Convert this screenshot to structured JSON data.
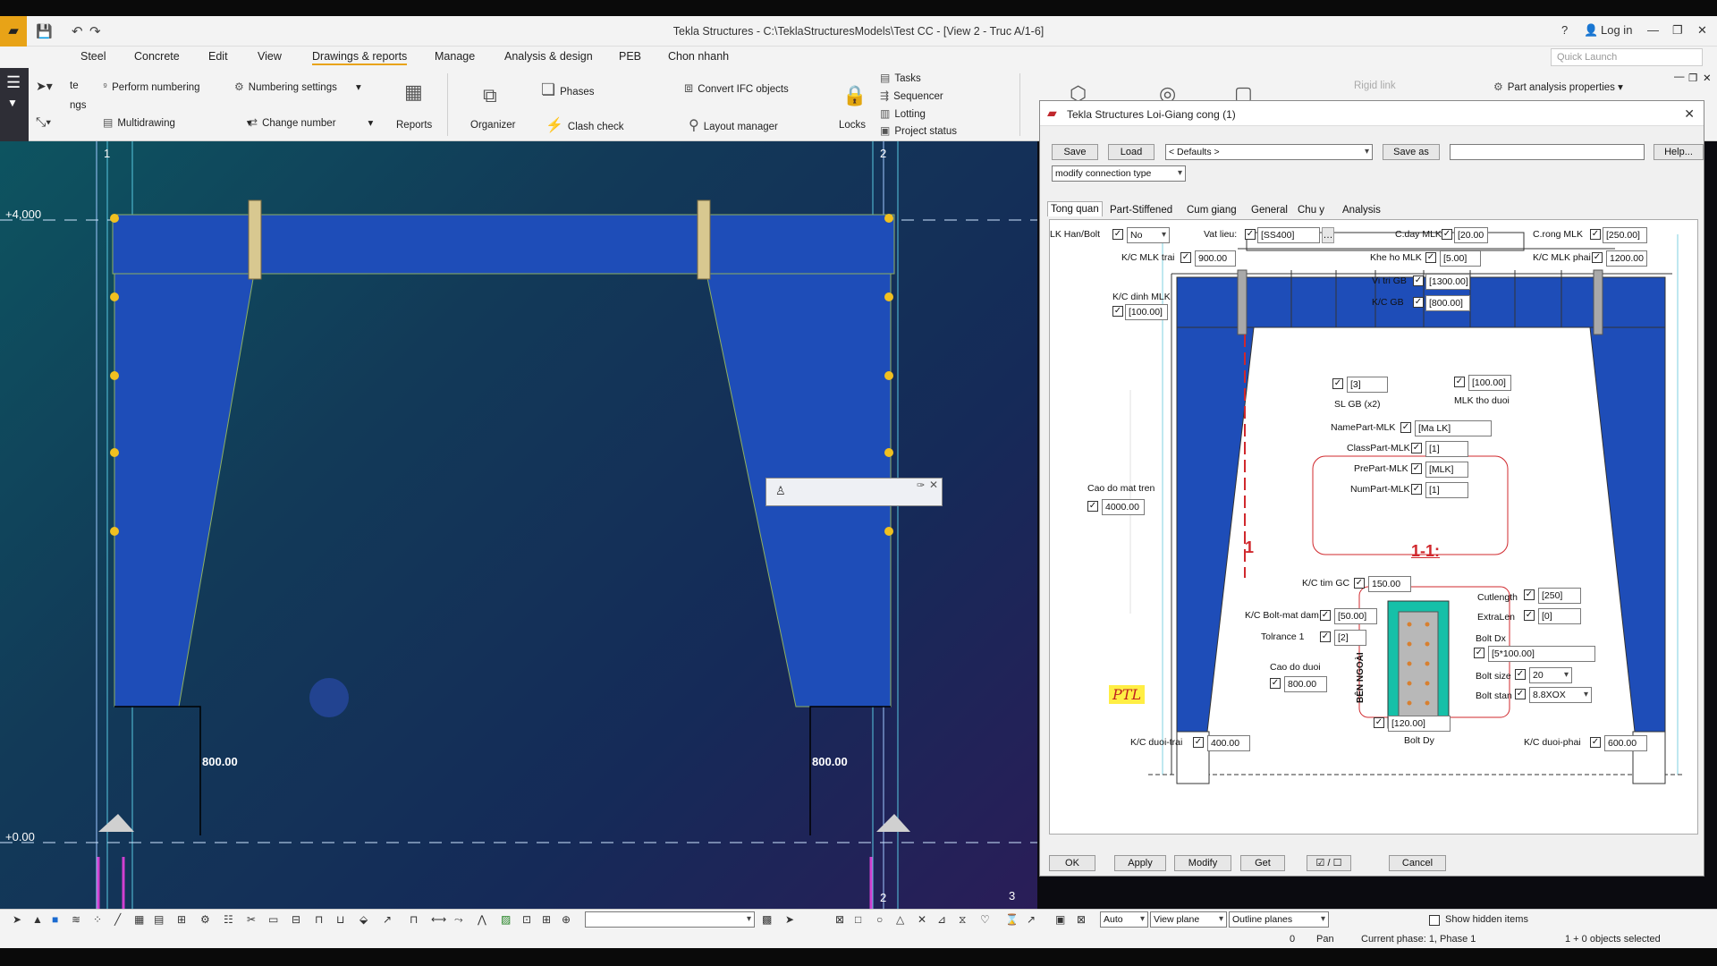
{
  "window": {
    "title": "Tekla Structures - C:\\TeklaStructuresModels\\Test CC - [View 2 - Truc A/1-6]",
    "login": "Log in",
    "help": "?"
  },
  "menu": [
    "Steel",
    "Concrete",
    "Edit",
    "View",
    "Drawings & reports",
    "Manage",
    "Analysis & design",
    "PEB",
    "Chon nhanh"
  ],
  "quick_launch": "Quick Launch",
  "ribbon": {
    "perform_numbering": "Perform numbering",
    "numbering_settings": "Numbering settings",
    "multidrawing": "Multidrawing",
    "change_number": "Change number",
    "reports": "Reports",
    "organizer": "Organizer",
    "phases": "Phases",
    "clash_check": "Clash check",
    "convert_ifc": "Convert IFC objects",
    "layout_manager": "Layout manager",
    "locks": "Locks",
    "tasks": "Tasks",
    "sequencer": "Sequencer",
    "lotting": "Lotting",
    "project_status": "Project status",
    "rigid_link": "Rigid link",
    "part_analysis": "Part analysis properties",
    "te": "te",
    "ngs": "ngs"
  },
  "viewport": {
    "grid_1": "1",
    "grid_2": "2",
    "grid_2b": "2",
    "grid_3": "3",
    "level_top": "+4,000",
    "level_bottom": "+0.00",
    "dim_left": "800.00",
    "dim_right": "800.00"
  },
  "dialog": {
    "title": "Tekla Structures  Loi-Giang cong (1)",
    "save": "Save",
    "load": "Load",
    "defaults": "< Defaults >",
    "save_as": "Save as",
    "save_as_value": "",
    "help": "Help...",
    "modify_type": "modify connection type",
    "tabs": [
      "Tong quan",
      "Part-Stiffened",
      "Cum giang",
      "General",
      "Chu y",
      "Analysis"
    ],
    "fields": {
      "lk_han_bolt_label": "LK Han/Bolt",
      "lk_han_bolt_value": "No",
      "vat_lieu_label": "Vat lieu:",
      "vat_lieu_value": "[SS400]",
      "cday_label": "C.day MLK",
      "cday_value": "[20.00",
      "crong_label": "C.rong MLK",
      "crong_value": "[250.00]",
      "kc_mlk_trai_label": "K/C MLK trai",
      "kc_mlk_trai_value": "900.00",
      "khe_ho_label": "Khe ho MLK",
      "khe_ho_value": "[5.00]",
      "kc_mlk_phai_label": "K/C MLK phai",
      "kc_mlk_phai_value": "1200.00",
      "vitri_gb_label": "Vi tri GB",
      "vitri_gb_value": "[1300.00]",
      "kc_gb_label": "K/C GB",
      "kc_gb_value": "[800.00]",
      "kc_dinh_label": "K/C dinh MLK",
      "kc_dinh_value": "[100.00]",
      "sl_gb_value": "[3]",
      "sl_gb_label": "SL GB (x2)",
      "mlk_tho_value": "[100.00]",
      "mlk_tho_label": "MLK tho duoi",
      "namepart_label": "NamePart-MLK",
      "namepart_value": "[Ma LK]",
      "classpart_label": "ClassPart-MLK",
      "classpart_value": "[1]",
      "prepart_label": "PrePart-MLK",
      "prepart_value": "[MLK]",
      "numpart_label": "NumPart-MLK",
      "numpart_value": "[1]",
      "cao_do_tren_label": "Cao do mat tren",
      "cao_do_tren_value": "4000.00",
      "section_mark": "1",
      "section_label": "1-1:",
      "kc_tim_gc_label": "K/C tim GC",
      "kc_tim_gc_value": "150.00",
      "kc_bolt_label": "K/C Bolt-mat dam",
      "kc_bolt_value": "[50.00]",
      "tolrance_label": "Tolrance 1",
      "tolrance_value": "[2]",
      "cutlength_label": "Cutlength",
      "cutlength_value": "[250]",
      "extralen_label": "ExtraLen",
      "extralen_value": "[0]",
      "bolt_dx_label": "Bolt Dx",
      "bolt_dx_value": "[5*100.00]",
      "ben_ngoai": "BÊN NGOÀI",
      "cao_do_duoi_label": "Cao do duoi",
      "cao_do_duoi_value": "800.00",
      "bolt_size_label": "Bolt size",
      "bolt_size_value": "20",
      "bolt_stan_label": "Bolt stan",
      "bolt_stan_value": "8.8XOX",
      "bolt_dy_value": "[120.00]",
      "bolt_dy_label": "Bolt Dy",
      "kc_duoi_trai_label": "K/C duoi-trai",
      "kc_duoi_trai_value": "400.00",
      "kc_duoi_phai_label": "K/C duoi-phai",
      "kc_duoi_phai_value": "600.00",
      "logo": "PTL"
    },
    "ok": "OK",
    "apply": "Apply",
    "modify": "Modify",
    "get": "Get",
    "toggle": "☑ / ☐",
    "cancel": "Cancel"
  },
  "status": {
    "auto": "Auto",
    "view_plane": "View plane",
    "outline_planes": "Outline planes",
    "show_hidden": "Show hidden items",
    "zero": "0",
    "pan": "Pan",
    "phase": "Current phase: 1, Phase 1",
    "selected": "1 + 0 objects selected"
  }
}
